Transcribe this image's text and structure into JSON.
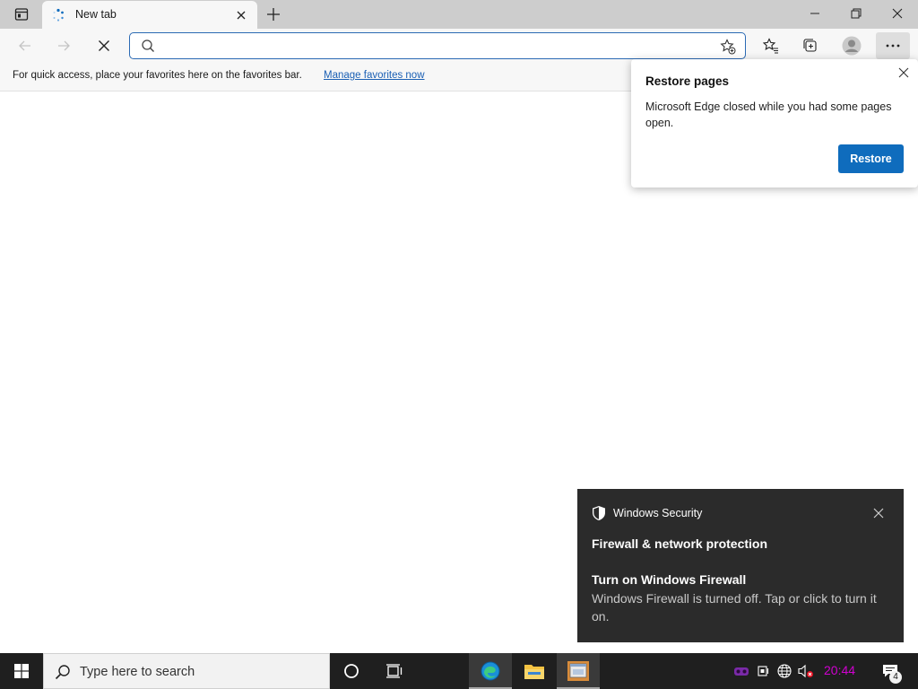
{
  "browser": {
    "tab": {
      "title": "New tab",
      "favicon": "loading-dots-icon"
    },
    "address": {
      "value": "",
      "placeholder": ""
    },
    "favorites_bar": {
      "text": "For quick access, place your favorites here on the favorites bar.",
      "link": "Manage favorites now"
    },
    "colors": {
      "titlebar": "#cdcdcd",
      "toolbar": "#f7f7f7",
      "accent": "#0f6cbd",
      "link": "#1a5fb4"
    }
  },
  "restore_popup": {
    "title": "Restore pages",
    "message": "Microsoft Edge closed while you had some pages open.",
    "button": "Restore"
  },
  "toast": {
    "app": "Windows Security",
    "header": "Firewall & network protection",
    "title": "Turn on Windows Firewall",
    "body": "Windows Firewall is turned off. Tap or click to turn it on."
  },
  "taskbar": {
    "search_placeholder": "Type here to search",
    "clock": "20:44",
    "notification_count": "4",
    "clock_color": "#d100d1"
  }
}
